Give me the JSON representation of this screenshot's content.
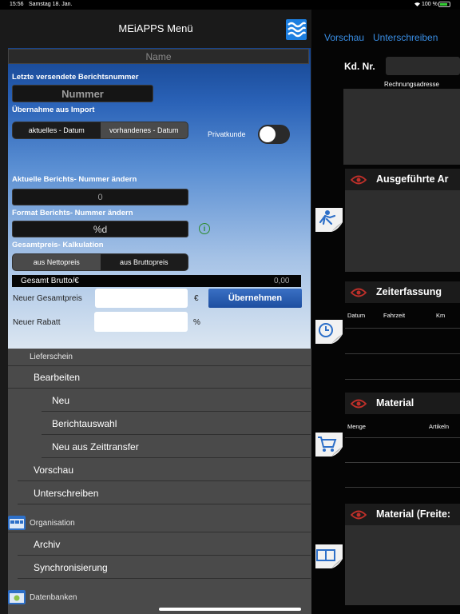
{
  "status": {
    "time": "15:56",
    "date": "Samstag 18. Jan.",
    "battery": "100 %"
  },
  "menu": {
    "title": "MEiAPPS Menü",
    "name_placeholder": "Name"
  },
  "form": {
    "last_report_label": "Letzte versendete Berichtsnummer",
    "nummer_placeholder": "Nummer",
    "import_label": "Übernahme aus Import",
    "import_options": [
      "aktuelles - Datum",
      "vorhandenes - Datum"
    ],
    "privatkunde_label": "Privatkunde",
    "change_number_label": "Aktuelle Berichts- Nummer ändern",
    "change_number_value": "0",
    "format_label": "Format Berichts- Nummer ändern",
    "format_value": "%d",
    "info_glyph": "i",
    "calc_label": "Gesamtpreis- Kalkulation",
    "calc_options": [
      "aus Nettopreis",
      "aus Bruttopreis"
    ],
    "gesamt_label": "Gesamt Brutto/€",
    "gesamt_value": "0,00",
    "new_total_label": "Neuer Gesamtpreis",
    "currency": "€",
    "new_discount_label": "Neuer Rabatt",
    "percent": "%",
    "apply_button": "Übernehmen"
  },
  "menu_list": {
    "section_lieferschein": "Lieferschein",
    "bearbeiten": "Bearbeiten",
    "neu": "Neu",
    "berichtauswahl": "Berichtauswahl",
    "neu_zeittransfer": "Neu aus Zeittransfer",
    "vorschau": "Vorschau",
    "unterschreiben": "Unterschreiben",
    "section_organisation": "Organisation",
    "archiv": "Archiv",
    "synchronisierung": "Synchronisierung",
    "section_datenbanken": "Datenbanken"
  },
  "detail": {
    "vorschau_link": "Vorschau",
    "unterschreiben_link": "Unterschreiben",
    "kdnr_label": "Kd. Nr.",
    "rechnung_label": "Rechnungsadresse",
    "sections": {
      "ausgefuehrte": "Ausgeführte Ar",
      "zeiterfassung": "Zeiterfassung",
      "material": "Material",
      "material_freitext": "Material (Freite:"
    },
    "zeit_columns": [
      "Datum",
      "Fahrzeit",
      "Km"
    ],
    "material_columns": [
      "Menge",
      "Artikeln"
    ]
  },
  "colors": {
    "link": "#3a8fe6",
    "eye": "#c0302a",
    "button": "#1d4ea0"
  }
}
